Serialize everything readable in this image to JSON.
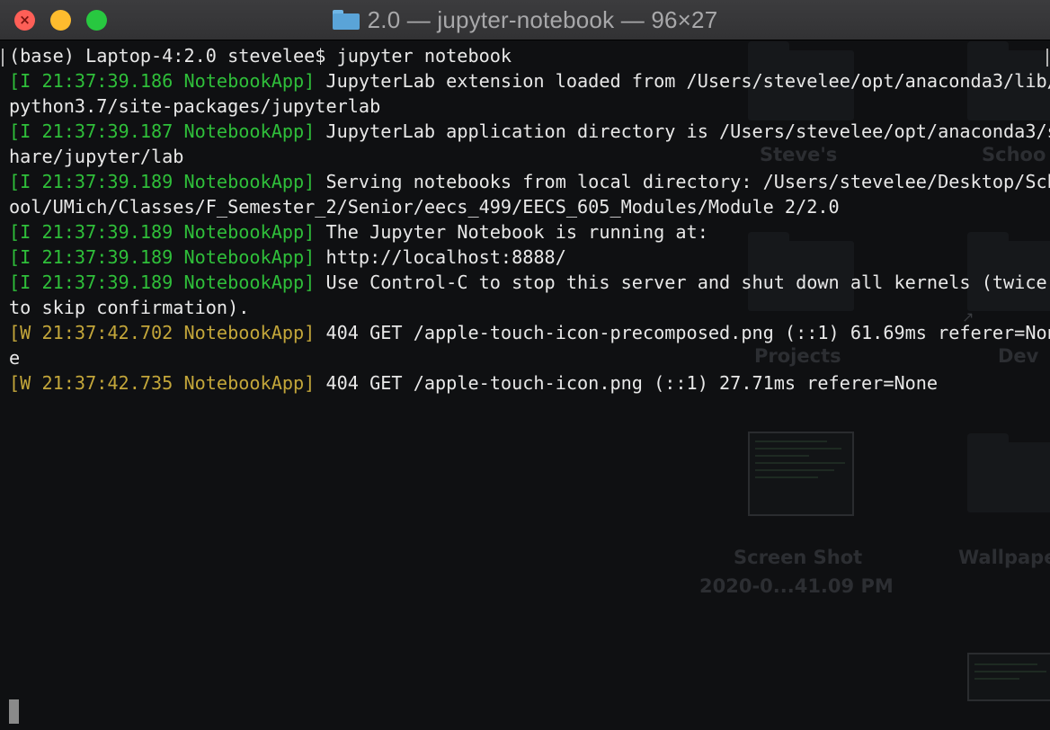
{
  "window": {
    "title": "2.0 — jupyter-notebook — 96×27"
  },
  "desktop": {
    "labels": {
      "steves": "Steve's",
      "school": "Schoo",
      "projects": "Projects",
      "dev": "Dev",
      "screenshot_line1": "Screen Shot",
      "screenshot_line2": "2020-0...41.09 PM",
      "wallpaper": "Wallpape"
    }
  },
  "terminal": {
    "prompt_line": "(base) Laptop-4:2.0 stevelee$ jupyter notebook",
    "lines": [
      {
        "prefix": "[I 21:37:39.186 NotebookApp]",
        "text": " JupyterLab extension loaded from /Users/stevelee/opt/anaconda3/lib/",
        "level": "info"
      },
      {
        "prefix": "",
        "text": "python3.7/site-packages/jupyterlab",
        "level": "plain"
      },
      {
        "prefix": "[I 21:37:39.187 NotebookApp]",
        "text": " JupyterLab application directory is /Users/stevelee/opt/anaconda3/s",
        "level": "info"
      },
      {
        "prefix": "",
        "text": "hare/jupyter/lab",
        "level": "plain"
      },
      {
        "prefix": "[I 21:37:39.189 NotebookApp]",
        "text": " Serving notebooks from local directory: /Users/stevelee/Desktop/Sch",
        "level": "info"
      },
      {
        "prefix": "",
        "text": "ool/UMich/Classes/F_Semester_2/Senior/eecs_499/EECS_605_Modules/Module 2/2.0",
        "level": "plain"
      },
      {
        "prefix": "[I 21:37:39.189 NotebookApp]",
        "text": " The Jupyter Notebook is running at:",
        "level": "info"
      },
      {
        "prefix": "[I 21:37:39.189 NotebookApp]",
        "text": " http://localhost:8888/",
        "level": "info"
      },
      {
        "prefix": "[I 21:37:39.189 NotebookApp]",
        "text": " Use Control-C to stop this server and shut down all kernels (twice",
        "level": "info"
      },
      {
        "prefix": "",
        "text": "to skip confirmation).",
        "level": "plain"
      },
      {
        "prefix": "[W 21:37:42.702 NotebookApp]",
        "text": " 404 GET /apple-touch-icon-precomposed.png (::1) 61.69ms referer=Non",
        "level": "warn"
      },
      {
        "prefix": "",
        "text": "e",
        "level": "plain"
      },
      {
        "prefix": "[W 21:37:42.735 NotebookApp]",
        "text": " 404 GET /apple-touch-icon.png (::1) 27.71ms referer=None",
        "level": "warn"
      }
    ]
  },
  "colors": {
    "info_prefix": "#2fbf3a",
    "warn_prefix": "#c3a63a",
    "text": "#e8e8e8",
    "background": "#0f1012"
  },
  "icons": {
    "title_folder": "folder-icon",
    "close": "close-icon",
    "minimize": "minimize-icon",
    "zoom": "zoom-icon"
  }
}
